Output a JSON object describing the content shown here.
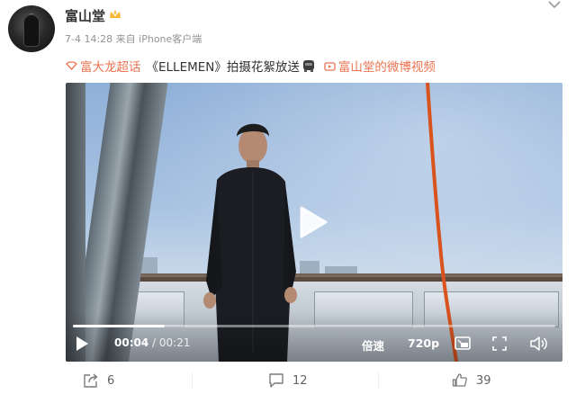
{
  "post": {
    "author": "富山堂",
    "meta": "7-4 14:28  来自 iPhone客户端",
    "text": {
      "topic": "富大龙超话",
      "body": "《ELLEMEN》拍摄花絮放送",
      "video_link": "富山堂的微博视频"
    }
  },
  "video": {
    "current_time": "00:04",
    "separator": " / ",
    "duration": "00:21",
    "progress": 0.19,
    "speed_label": "倍速",
    "quality_label": "720p"
  },
  "footer": {
    "share_count": "6",
    "comment_count": "12",
    "like_count": "39"
  },
  "colors": {
    "link": "#eb7350",
    "meta": "#939393",
    "crown": "#f7b731"
  },
  "icons": [
    "crown-icon",
    "more-icon",
    "tag-icon",
    "emoji-icon",
    "video-link-icon",
    "play-icon",
    "pip-icon",
    "fullscreen-icon",
    "volume-icon",
    "share-icon",
    "comment-icon",
    "like-icon"
  ]
}
